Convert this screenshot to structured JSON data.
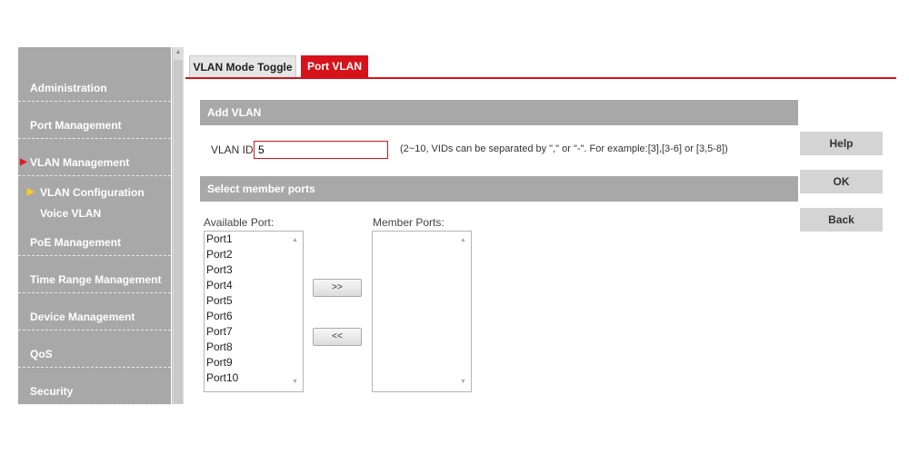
{
  "sidebar": {
    "items": [
      {
        "label": "Administration"
      },
      {
        "label": "Port Management"
      },
      {
        "label": "VLAN Management"
      },
      {
        "label": "PoE Management"
      },
      {
        "label": "Time Range Management"
      },
      {
        "label": "Device Management"
      },
      {
        "label": "QoS"
      },
      {
        "label": "Security"
      }
    ],
    "subitems": [
      {
        "label": "VLAN Configuration"
      },
      {
        "label": "Voice VLAN"
      }
    ]
  },
  "tabs": [
    {
      "label": "VLAN Mode Toggle"
    },
    {
      "label": "Port VLAN"
    }
  ],
  "add_vlan": {
    "title": "Add VLAN",
    "vlan_id_label": "VLAN ID",
    "vlan_id_value": "5",
    "hint": "(2~10, VIDs can be separated by \",\" or \"-\". For example:[3],[3-6] or [3,5-8])"
  },
  "members": {
    "title": "Select member ports",
    "available_label": "Available Port:",
    "member_label": "Member Ports:",
    "available_ports": [
      "Port1",
      "Port2",
      "Port3",
      "Port4",
      "Port5",
      "Port6",
      "Port7",
      "Port8",
      "Port9",
      "Port10"
    ],
    "member_ports": [],
    "add_label": ">>",
    "remove_label": "<<"
  },
  "actions": {
    "help": "Help",
    "ok": "OK",
    "back": "Back"
  },
  "colors": {
    "accent": "#d6121b",
    "sidebar": "#a8a8a8",
    "indicator_yellow": "#f2d21b"
  }
}
